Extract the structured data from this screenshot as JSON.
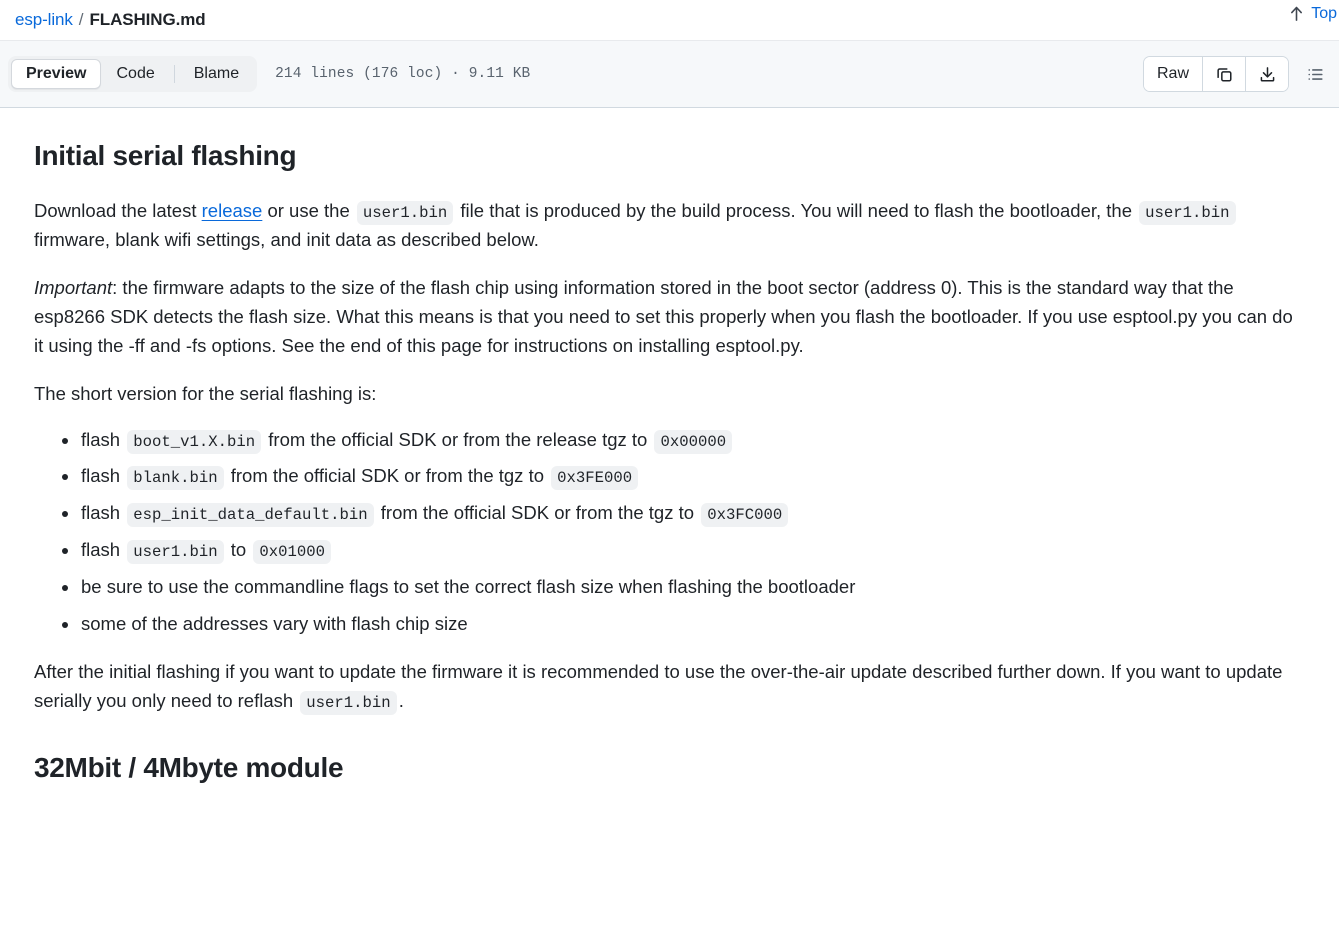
{
  "breadcrumb": {
    "repo": "esp-link",
    "separator": "/",
    "file": "FLASHING.md",
    "top_label": "Top",
    "top_icon": "arrow-up-icon"
  },
  "toolbar": {
    "tabs": [
      {
        "label": "Preview",
        "selected": true
      },
      {
        "label": "Code",
        "selected": false
      },
      {
        "label": "Blame",
        "selected": false
      }
    ],
    "file_meta": "214 lines (176 loc) · 9.11 KB",
    "raw_label": "Raw",
    "copy_icon": "copy-icon",
    "download_icon": "download-icon",
    "outline_icon": "outline-list-icon"
  },
  "document": {
    "heading_1": "Initial serial flashing",
    "paragraph_1": {
      "a": "Download the latest ",
      "link": "release",
      "b": " or use the ",
      "code1": "user1.bin",
      "c": " file that is produced by the build process. You will need to flash the bootloader, the ",
      "code2": "user1.bin",
      "d": " firmware, blank wifi settings, and init data as described below."
    },
    "paragraph_2": {
      "emphasis": "Important",
      "text": ": the firmware adapts to the size of the flash chip using information stored in the boot sector (address 0). This is the standard way that the esp8266 SDK detects the flash size. What this means is that you need to set this properly when you flash the bootloader. If you use esptool.py you can do it using the -ff and -fs options. See the end of this page for instructions on installing esptool.py."
    },
    "paragraph_3": "The short version for the serial flashing is:",
    "list": [
      {
        "pre": "flash ",
        "code1": "boot_v1.X.bin",
        "mid": " from the official SDK or from the release tgz to ",
        "code2": "0x00000",
        "post": ""
      },
      {
        "pre": "flash ",
        "code1": "blank.bin",
        "mid": " from the official SDK or from the tgz to ",
        "code2": "0x3FE000",
        "post": ""
      },
      {
        "pre": "flash ",
        "code1": "esp_init_data_default.bin",
        "mid": " from the official SDK or from the tgz to ",
        "code2": "0x3FC000",
        "post": ""
      },
      {
        "pre": "flash ",
        "code1": "user1.bin",
        "mid": " to ",
        "code2": "0x01000",
        "post": ""
      },
      {
        "pre": "be sure to use the commandline flags to set the correct flash size when flashing the bootloader",
        "code1": "",
        "mid": "",
        "code2": "",
        "post": ""
      },
      {
        "pre": "some of the addresses vary with flash chip size",
        "code1": "",
        "mid": "",
        "code2": "",
        "post": ""
      }
    ],
    "paragraph_4": {
      "a": "After the initial flashing if you want to update the firmware it is recommended to use the over-the-air update described further down. If you want to update serially you only need to reflash ",
      "code": "user1.bin",
      "b": "."
    },
    "heading_2": "32Mbit / 4Mbyte module"
  },
  "colors": {
    "link": "#0969da",
    "text": "#1f2328",
    "muted": "#59636e",
    "toolbar_bg": "#f6f8fa",
    "code_bg": "#eff1f3",
    "border": "#d1d9e0"
  }
}
